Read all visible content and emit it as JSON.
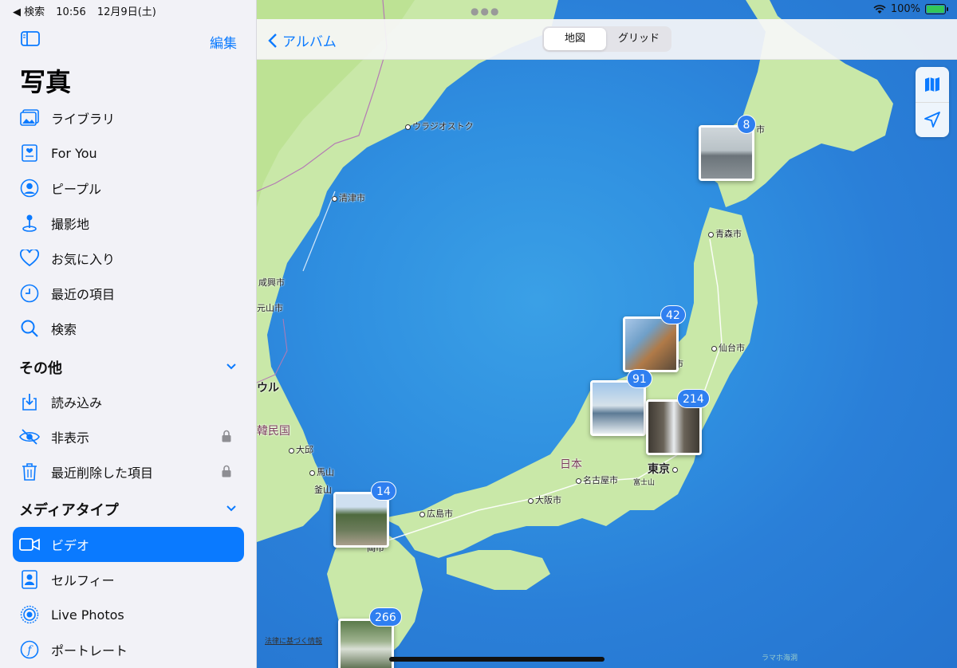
{
  "status": {
    "back_app": "◀ 検索",
    "time": "10:56",
    "date": "12月9日(土)",
    "battery": "100%"
  },
  "sidebar": {
    "edit": "編集",
    "title": "写真",
    "items": [
      {
        "label": "ライブラリ",
        "icon": "photo-library-icon"
      },
      {
        "label": "For You",
        "icon": "for-you-icon"
      },
      {
        "label": "ピープル",
        "icon": "person-icon"
      },
      {
        "label": "撮影地",
        "icon": "location-pin-icon"
      },
      {
        "label": "お気に入り",
        "icon": "heart-icon"
      },
      {
        "label": "最近の項目",
        "icon": "clock-icon"
      },
      {
        "label": "検索",
        "icon": "search-icon"
      }
    ],
    "other_title": "その他",
    "other_items": [
      {
        "label": "読み込み",
        "icon": "import-icon"
      },
      {
        "label": "非表示",
        "icon": "eye-slash-icon"
      },
      {
        "label": "最近削除した項目",
        "icon": "trash-icon"
      }
    ],
    "media_title": "メディアタイプ",
    "media_items": [
      {
        "label": "ビデオ",
        "icon": "video-icon",
        "selected": true
      },
      {
        "label": "セルフィー",
        "icon": "selfie-icon"
      },
      {
        "label": "Live Photos",
        "icon": "live-photos-icon"
      },
      {
        "label": "ポートレート",
        "icon": "portrait-icon"
      }
    ]
  },
  "toolbar": {
    "back_label": "アルバム",
    "seg_map": "地図",
    "seg_grid": "グリッド"
  },
  "map": {
    "labels": {
      "vladivostok": "ウラジオストク",
      "qingjin": "清津市",
      "xianxing": "咸興市",
      "yuanshan": "元山市",
      "seoul": "ウル",
      "korea": "韓民国",
      "daegu": "大邱",
      "masan": "馬山",
      "busan": "釜山",
      "aomori": "青森市",
      "sendai": "仙台市",
      "japan": "日本",
      "tokyo": "東京",
      "nagoya": "名古屋市",
      "osaka": "大阪市",
      "hiroshima": "広島市",
      "fuji": "富士山",
      "fukuoka_partial": "岡市",
      "hokkaido_city": "市",
      "niigata_partial": "市"
    },
    "clusters": [
      {
        "count": "8"
      },
      {
        "count": "42"
      },
      {
        "count": "91"
      },
      {
        "count": "214"
      },
      {
        "count": "14"
      },
      {
        "count": "266"
      }
    ],
    "legal": "法律に基づく情報",
    "attribution": "ラマホ海洞"
  }
}
